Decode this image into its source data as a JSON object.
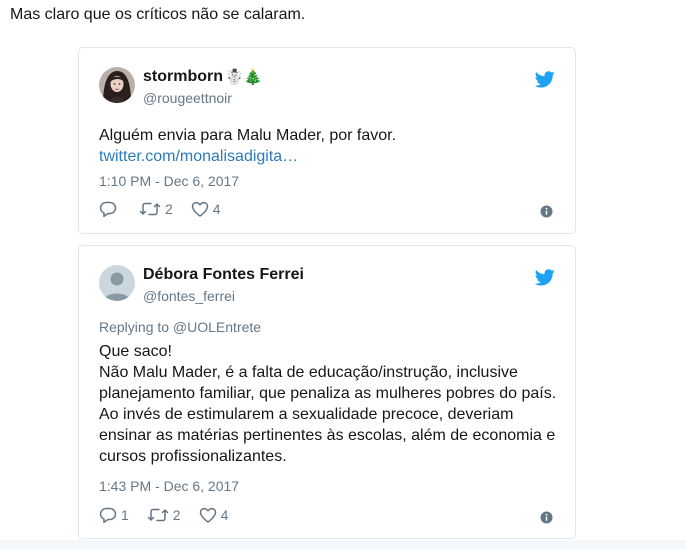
{
  "intro": "Mas claro que os críticos não se calaram.",
  "tweets": [
    {
      "name": "stormborn",
      "emoji": "☃️🎄",
      "handle": "@rougeettnoir",
      "text": "Alguém envia para Malu Mader, por favor.",
      "link": "twitter.com/monalisadigita…",
      "timestamp": "1:10 PM - Dec 6, 2017",
      "reply_count": "",
      "retweet_count": "2",
      "like_count": "4"
    },
    {
      "name": "Débora Fontes Ferrei",
      "handle": "@fontes_ferrei",
      "replying_to": "Replying to @UOLEntrete",
      "text_lines": [
        "Que saco!",
        "Não Malu Mader, é a falta de educação/instrução, inclusive",
        "planejamento familiar, que penaliza as mulheres pobres do país.",
        "Ao invés de estimularem a sexualidade precoce, deveriam",
        "ensinar as matérias pertinentes às escolas, além de economia e",
        "cursos profissionalizantes."
      ],
      "timestamp": "1:43 PM - Dec 6, 2017",
      "reply_count": "1",
      "retweet_count": "2",
      "like_count": "4"
    }
  ],
  "colors": {
    "twitter_blue": "#1da1f2",
    "link": "#2b7bb9",
    "secondary_text": "#657786",
    "border": "#e1e8ed"
  },
  "icons": [
    "twitter-bird-icon",
    "reply-icon",
    "retweet-icon",
    "like-icon",
    "info-icon"
  ]
}
